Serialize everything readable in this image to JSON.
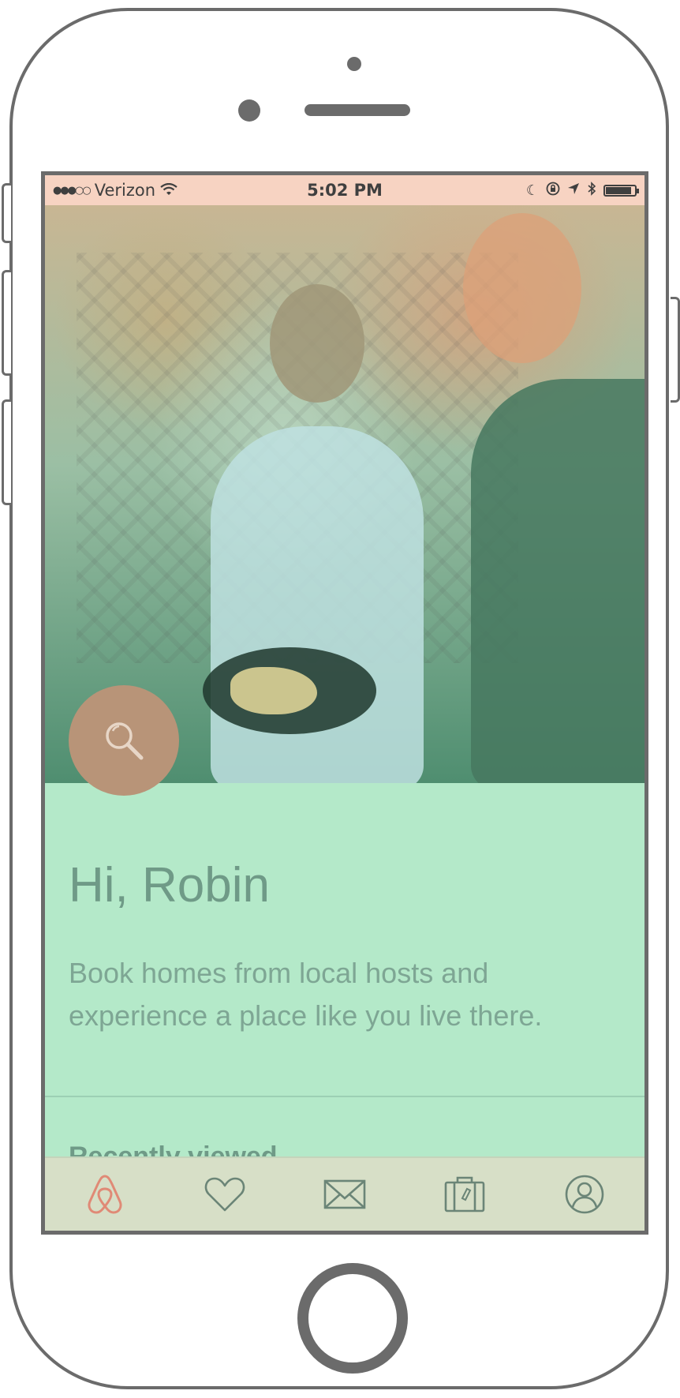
{
  "status_bar": {
    "carrier": "Verizon",
    "time": "5:02 PM"
  },
  "home": {
    "greeting": "Hi, Robin",
    "tagline": "Book homes from local hosts and experience a place like you live there.",
    "section_title": "Recently viewed"
  },
  "tab_bar": {
    "items": [
      {
        "icon": "airbnb-logo-icon"
      },
      {
        "icon": "heart-icon"
      },
      {
        "icon": "envelope-icon"
      },
      {
        "icon": "suitcase-icon"
      },
      {
        "icon": "profile-icon"
      }
    ]
  },
  "colors": {
    "accent": "#e08a76",
    "icon_gray": "#6b8577",
    "search_button": "#b89478",
    "content_bg": "#b4e9c9"
  }
}
